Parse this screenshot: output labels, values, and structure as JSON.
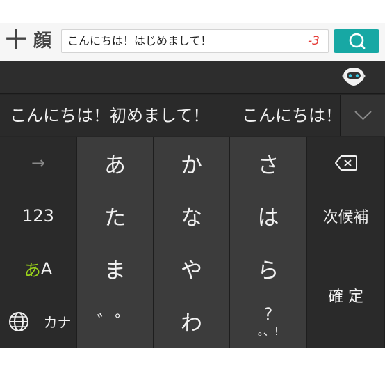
{
  "appbar": {
    "plus_label": "十",
    "kaomoji_label": "顔",
    "search_value": "こんにちは！はじめまして！",
    "remaining_count": "-3"
  },
  "candidates": {
    "items": [
      "こんにちは！初めまして！",
      "こんにちは！"
    ]
  },
  "keyboard": {
    "left": {
      "arrow": "→",
      "num": "123",
      "kana_mode_a": "あ",
      "kana_mode_b": "A",
      "katakana": "カナ"
    },
    "grid": [
      "あ",
      "か",
      "さ",
      "た",
      "な",
      "は",
      "ま",
      "や",
      "ら",
      "゛゜",
      "わ"
    ],
    "punct": {
      "top": "?",
      "bottom": "。、!"
    },
    "right": {
      "next_candidate": "次候補",
      "confirm": "確 定"
    }
  },
  "colors": {
    "accent_teal": "#17a8a4",
    "count_red": "#e53935",
    "mode_green": "#9ad41a"
  }
}
